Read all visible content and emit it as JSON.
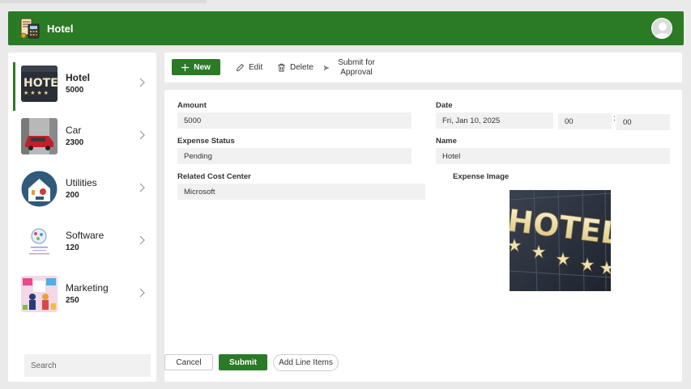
{
  "header": {
    "title": "Hotel",
    "app_icon": "calculator-receipt-icon",
    "avatar_icon": "user-avatar-icon"
  },
  "sidebar": {
    "items": [
      {
        "label": "Hotel",
        "amount": "5000",
        "thumb": "hotel-thumbnail"
      },
      {
        "label": "Car",
        "amount": "2300",
        "thumb": "car-thumbnail"
      },
      {
        "label": "Utilities",
        "amount": "200",
        "thumb": "utilities-thumbnail"
      },
      {
        "label": "Software",
        "amount": "120",
        "thumb": "software-thumbnail"
      },
      {
        "label": "Marketing",
        "amount": "250",
        "thumb": "marketing-thumbnail"
      }
    ],
    "search_placeholder": "Search"
  },
  "toolbar": {
    "new_label": "New",
    "edit_label": "Edit",
    "delete_label": "Delete",
    "submit_label": "Submit for Approval"
  },
  "form": {
    "amount_label": "Amount",
    "amount_value": "5000",
    "date_label": "Date",
    "date_value": "Fri, Jan 10, 2025",
    "hour_value": "00",
    "minute_value": "00",
    "time_separator": ":",
    "status_label": "Expense Status",
    "status_value": "Pending",
    "name_label": "Name",
    "name_value": "Hotel",
    "cost_center_label": "Related Cost Center",
    "cost_center_value": "Microsoft",
    "image_label": "Expense Image"
  },
  "actions": {
    "cancel_label": "Cancel",
    "submit_label": "Submit",
    "line_items_label": "Add Line Items"
  },
  "colors": {
    "brand_green": "#2b7a26"
  }
}
